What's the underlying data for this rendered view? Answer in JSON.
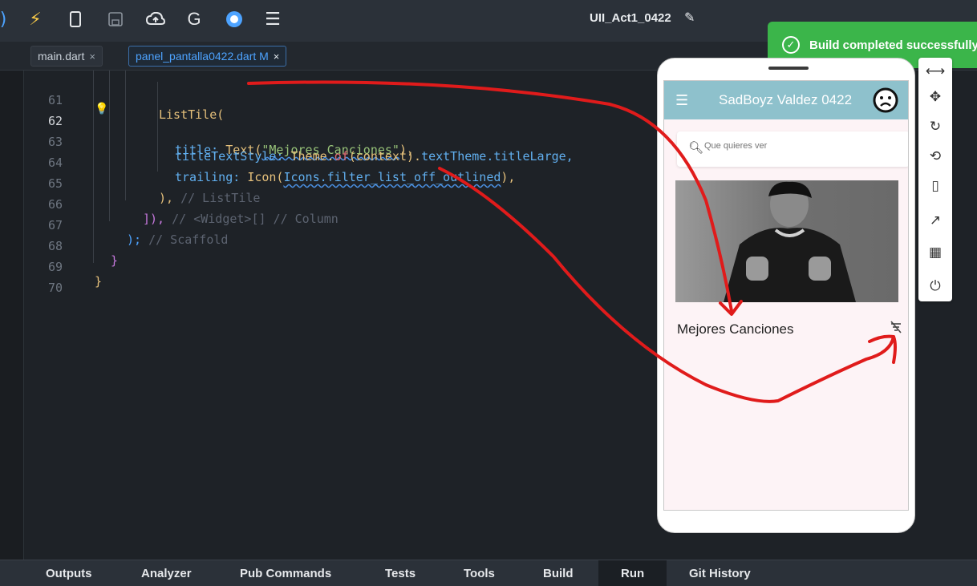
{
  "toolbar": {
    "icons": [
      "lightning-icon",
      "device-icon",
      "save-icon",
      "cloud-upload-icon",
      "google-icon",
      "record-icon",
      "menu-icon"
    ],
    "project_title": "UII_Act1_0422"
  },
  "tabs": [
    {
      "label": "main.dart",
      "close": "×"
    },
    {
      "label": "panel_pantalla0422.dart M",
      "close": "×"
    }
  ],
  "editor": {
    "lines": [
      {
        "num": "61",
        "active": false
      },
      {
        "num": "62",
        "active": true
      },
      {
        "num": "63",
        "active": false
      },
      {
        "num": "64",
        "active": false
      },
      {
        "num": "65",
        "active": false
      },
      {
        "num": "66",
        "active": false
      },
      {
        "num": "67",
        "active": false
      },
      {
        "num": "68",
        "active": false
      },
      {
        "num": "69",
        "active": false
      },
      {
        "num": "70",
        "active": false
      }
    ],
    "code": {
      "l61": "ListTile(",
      "l62_a": "title: ",
      "l62_b": "Text(",
      "l62_c": "\"Mejores Canciones\"",
      "l62_d": "),",
      "l63_a": "titleTextStyle: ",
      "l63_b": "Theme.",
      "l63_c": "of",
      "l63_d": "(context).",
      "l63_e": "textTheme",
      "l63_f": ".titleLarge,",
      "l64_a": "trailing: ",
      "l64_b": "Icon(",
      "l64_c": "Icons.filter_list_off_outlined",
      "l64_d": "),",
      "l65_a": "),",
      "l65_b": " // ListTile",
      "l66_a": "]),",
      "l66_b": " // <Widget>[] // Column",
      "l67_a": ");",
      "l67_b": " // Scaffold",
      "l68": "}",
      "l69": "}"
    }
  },
  "toast": {
    "message": "Build completed successfully"
  },
  "phone": {
    "app_title": "SadBoyz Valdez 0422",
    "search_placeholder": "Que quieres ver",
    "list_title": "Mejores Canciones"
  },
  "device_toolbar": [
    "resize-icon",
    "move-icon",
    "rotate-icon",
    "orientation-icon",
    "device-frame-icon",
    "open-external-icon",
    "qr-code-icon",
    "power-icon"
  ],
  "bottom_tabs": [
    "Outputs",
    "Analyzer",
    "Pub Commands",
    "Tests",
    "Tools",
    "Build",
    "Run",
    "Git History"
  ],
  "colors": {
    "accent": "#4da3ff",
    "toast": "#3bb54a",
    "appbar": "#8ec1cc",
    "annotation": "#e01b1b"
  }
}
